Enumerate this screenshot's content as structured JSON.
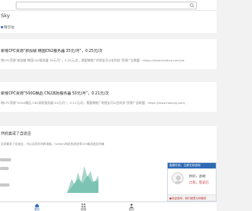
{
  "header": {
    "search_placeholder": "搜索..."
  },
  "brand": {
    "title": "Sky",
    "subtitle": "精华帖"
  },
  "posts": [
    {
      "title": "新增CPC资源“新加坡 韩国CN2服务器 35元/月”，0.25元/次",
      "desc": "增CPC资源“新加坡 韩国CN2服务器 35元/月”，0.25元/次，需要做推广的朋友可以在科技“资源广告联盟：https://www.haiduly.com/vw"
    },
    {
      "title": "新增CPC资源“500G精品 CN2高防服务器 50元/月”，0.21元/次",
      "desc": "增CPC资源“500G精品 CN2高防服务器 50元/月”，0.21元/次，需要做推广的朋友可以在科技“资源广告联盟：https://www.haiduly.com/"
    }
  ],
  "news": {
    "title": "然机集成了自适应",
    "desc": "站本集成了自适应，可以实现手机和电脑，haiduly网站系统自带100套自适应风格"
  },
  "chat": {
    "header": "客服在线，立即在线咨询",
    "msg1": "你好，咨询",
    "msg2": "点我，登录后",
    "footer": "●欢迎咨询，我们就是为你服务"
  },
  "nav": {
    "item1": "首页",
    "item2": "频道",
    "item3": "我的"
  },
  "colors": {
    "accent": "#2f6ab5",
    "danger": "#d04444"
  }
}
